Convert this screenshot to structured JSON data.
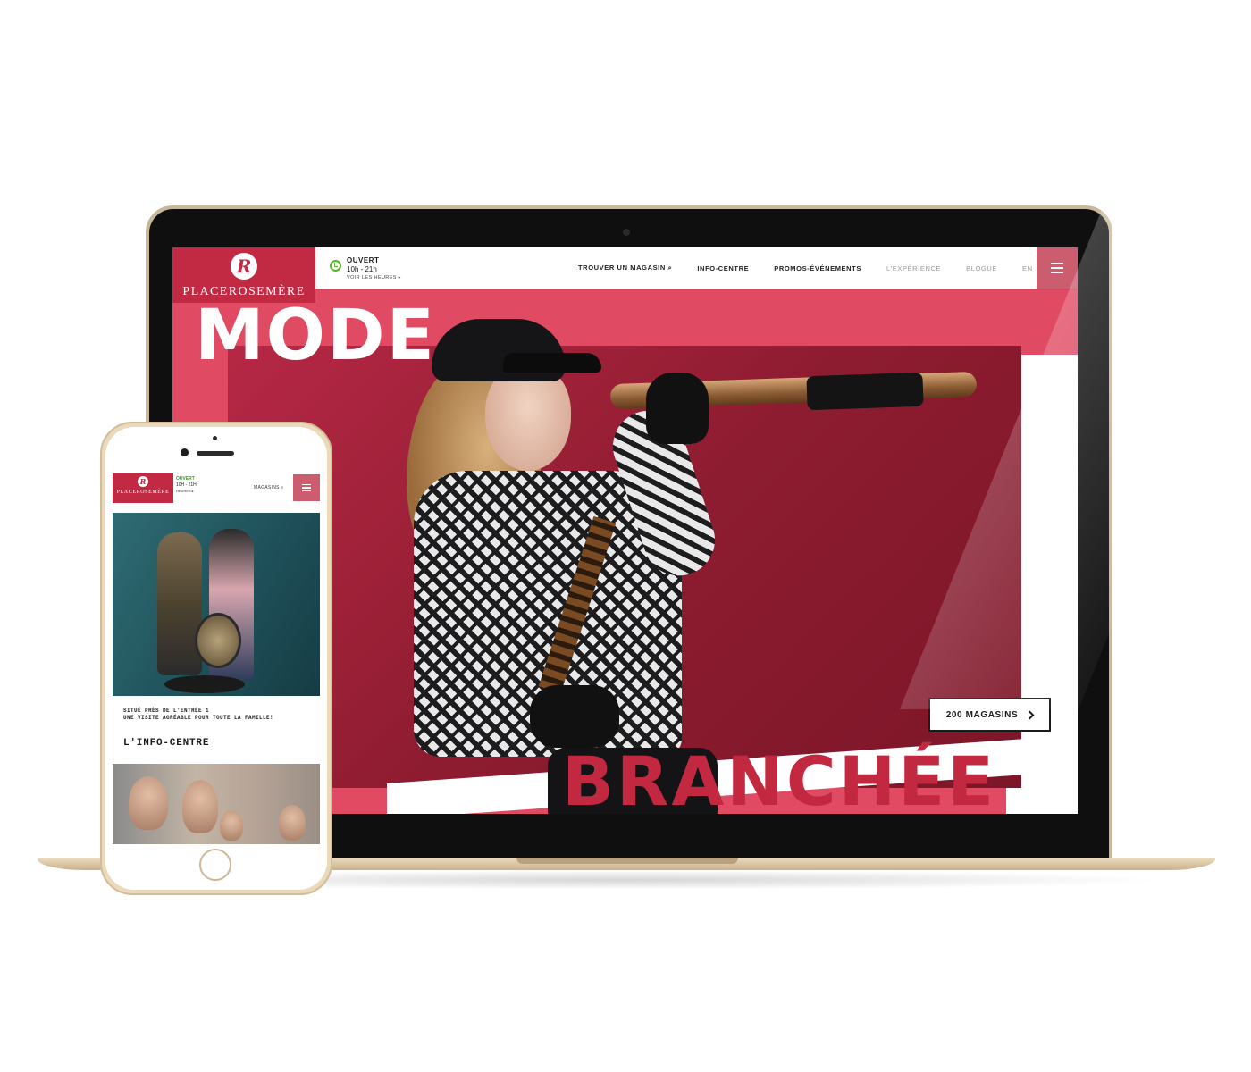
{
  "desktop": {
    "brand": {
      "logo_mark": "R",
      "name": "PLACEROSEMÈRE"
    },
    "hours": {
      "status": "OUVERT",
      "time": "10h - 21h",
      "link": "VOIR LES HEURES ▸"
    },
    "nav": {
      "items": [
        {
          "label": "TROUVER UN MAGASIN ⌕"
        },
        {
          "label": "INFO-CENTRE"
        },
        {
          "label": "PROMOS-ÉVÉNEMENTS"
        },
        {
          "label": "L'EXPÉRIENCE"
        },
        {
          "label": "BLOGUE"
        },
        {
          "label": "EN"
        }
      ]
    },
    "hero": {
      "title_top": "MODE",
      "title_bottom": "BRANCHÉE",
      "cta_label": "200 MAGASINS"
    }
  },
  "mobile": {
    "brand": {
      "logo_mark": "R",
      "name": "PLACEROSEMÈRE"
    },
    "hours": {
      "status": "OUVERT",
      "time": "10H - 21H",
      "link": "HEURES ▸"
    },
    "stores_label": "MAGASINS ⌕",
    "caption": "SITUÉ PRÈS DE L'ENTRÉE 1\nUNE VISITE AGRÉABLE POUR TOUTE LA FAMILLE!",
    "section_title": "L'INFO-CENTRE"
  },
  "colors": {
    "brand_red": "#c22a43",
    "hero_pink": "#e04a63",
    "menu_pink": "#cc5d6e",
    "open_green": "#5ab52d"
  },
  "icons": [
    "search-icon",
    "clock-icon",
    "menu-icon",
    "chevron-right-icon"
  ]
}
